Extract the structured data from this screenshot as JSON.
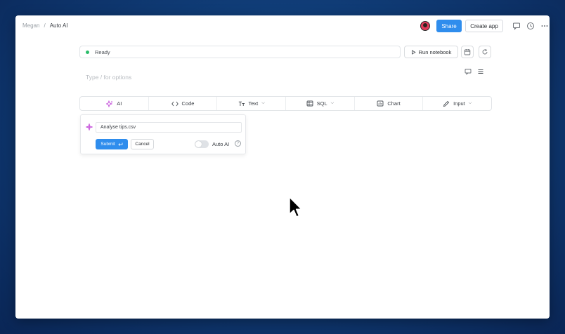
{
  "breadcrumb": {
    "parent": "Megan",
    "separator": "/",
    "current": "Auto AI"
  },
  "header": {
    "share_label": "Share",
    "create_app_label": "Create app"
  },
  "status": {
    "text": "Ready",
    "color": "#2bbd6a"
  },
  "run_notebook_label": "Run notebook",
  "editor": {
    "placeholder": "Type / for options"
  },
  "toolbar": {
    "items": [
      {
        "label": "AI",
        "icon": "sparkle-icon"
      },
      {
        "label": "Code",
        "icon": "code-icon"
      },
      {
        "label": "Text",
        "icon": "text-format-icon",
        "dropdown": true
      },
      {
        "label": "SQL",
        "icon": "database-icon",
        "dropdown": true
      },
      {
        "label": "Chart",
        "icon": "chart-icon"
      },
      {
        "label": "Input",
        "icon": "pencil-icon",
        "dropdown": true
      }
    ]
  },
  "ai_panel": {
    "prompt_value": "Analyse tips.csv",
    "submit_label": "Submit",
    "cancel_label": "Cancel",
    "auto_ai_label": "Auto AI",
    "auto_ai_enabled": false
  },
  "colors": {
    "accent": "#2f8ded",
    "ai": "#c34bd9",
    "background": "#103d78"
  }
}
